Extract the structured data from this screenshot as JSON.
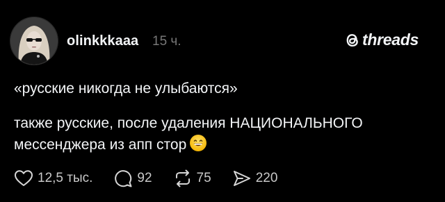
{
  "post": {
    "username": "olinkkkaaa",
    "time": "15 ч.",
    "brand": "threads",
    "quote_text": "«русские никогда не улыбаются»",
    "body_text": "также русские, после удаления НАЦИОНАЛЬНОГО\nмессенджера из апп стор",
    "emoji": "grinning-face-with-smiling-eyes"
  },
  "actions": {
    "likes": "12,5 тыс.",
    "replies": "92",
    "reposts": "75",
    "shares": "220"
  },
  "colors": {
    "background": "#000000",
    "text": "#f3f5f7",
    "muted": "#777777",
    "count": "#c9c9c9"
  }
}
